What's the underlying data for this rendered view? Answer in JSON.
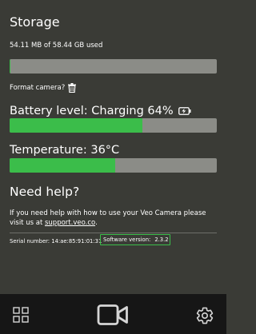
{
  "storage": {
    "title": "Storage",
    "usage_text": "54.11 MB of 58.44 GB used",
    "used_fraction": 0.001,
    "format_label": "Format camera?"
  },
  "battery": {
    "label": "Battery level: Charging 64%",
    "percent": 64
  },
  "temperature": {
    "label": "Temperature: 36°C",
    "percent": 51
  },
  "help": {
    "title": "Need help?",
    "text": "If you need help with how to use your Veo Camera please visit us at ",
    "link_text": "support.veo.co",
    "text_end": "."
  },
  "device": {
    "serial": "Serial number: 14:ae:85:91:01:31",
    "software_label": "Software version:",
    "software_version": "2.3.2"
  },
  "nav": {
    "icons": [
      "grid-icon",
      "camera-icon",
      "settings-icon"
    ]
  },
  "colors": {
    "background": "#3a3b36",
    "bar_track": "#8b8c87",
    "accent_green": "#3bbd4a",
    "bottom_bar": "#161616"
  }
}
